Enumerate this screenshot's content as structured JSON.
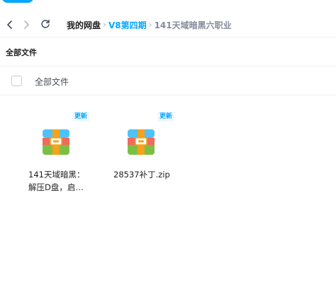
{
  "nav": {
    "back_icon": "chevron-left-icon",
    "forward_icon": "chevron-right-icon",
    "refresh_icon": "refresh-icon"
  },
  "breadcrumb": {
    "root": "我的网盘",
    "middle": "V8第四期",
    "current": "141天域暗黑六职业",
    "separator": "›"
  },
  "section": {
    "title": "全部文件"
  },
  "list_header": {
    "label": "全部文件"
  },
  "files": [
    {
      "name_line1": "141天域暗黑：",
      "name_line2": "解压D盘，启…",
      "badge": "更新",
      "icon": "archive-icon"
    },
    {
      "name_line1": "28537补丁.zip",
      "name_line2": "",
      "badge": "更新",
      "icon": "archive-icon"
    }
  ],
  "colors": {
    "accent": "#06a7ff",
    "breadcrumb_current": "#878c9c",
    "icon_top": "#4fc3f7",
    "icon_middle": "#f06b5b",
    "icon_bottom": "#7bc043",
    "icon_band": "#f7a21b"
  }
}
